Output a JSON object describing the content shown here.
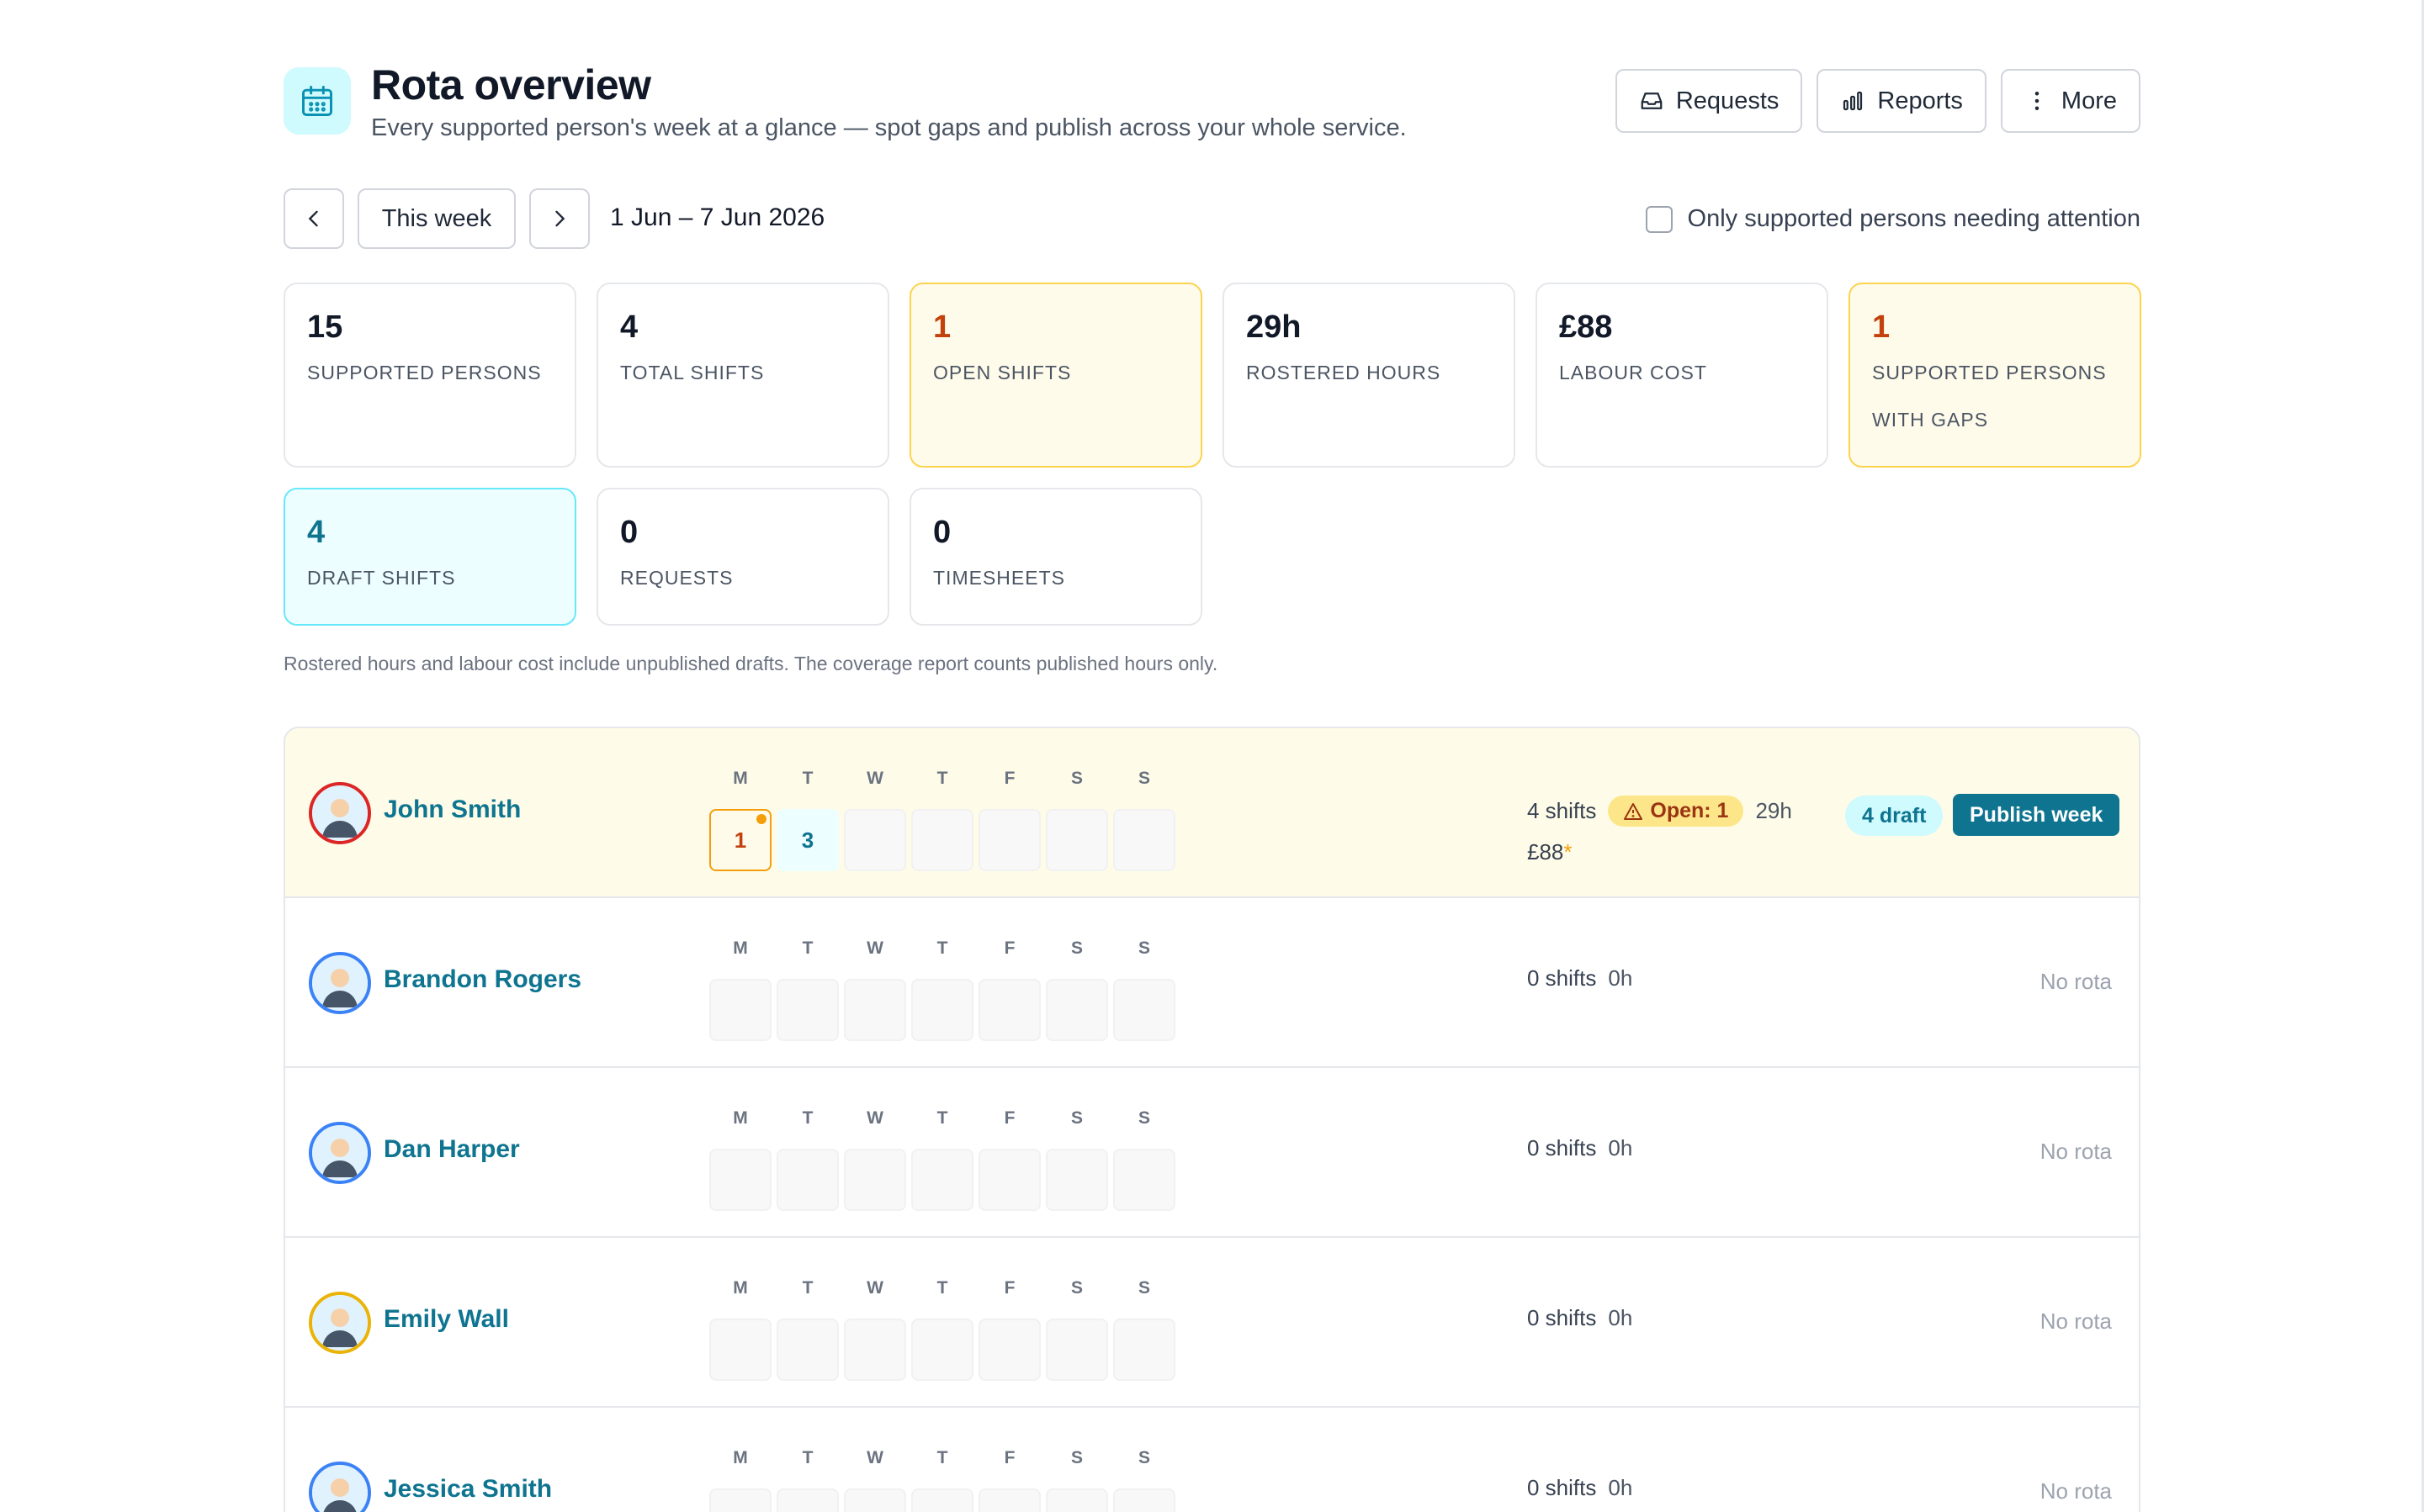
{
  "header": {
    "title": "Rota overview",
    "subtitle": "Every supported person's week at a glance — spot gaps and publish across your whole service.",
    "buttons": {
      "requests": "Requests",
      "reports": "Reports",
      "more": "More"
    }
  },
  "weeknav": {
    "this_week": "This week",
    "range": "1 Jun – 7 Jun 2026",
    "attention_filter": "Only supported persons needing attention"
  },
  "stats": [
    {
      "value": "15",
      "label": "Supported persons"
    },
    {
      "value": "4",
      "label": "Total shifts"
    },
    {
      "value": "1",
      "label": "Open shifts"
    },
    {
      "value": "29h",
      "label": "Rostered hours"
    },
    {
      "value": "£88",
      "label": "Labour cost"
    },
    {
      "value": "1",
      "label": "Supported persons with gaps"
    },
    {
      "value": "4",
      "label": "Draft shifts"
    },
    {
      "value": "0",
      "label": "Requests"
    },
    {
      "value": "0",
      "label": "Timesheets"
    }
  ],
  "note": "Rostered hours and labour cost include unpublished drafts. The coverage report counts published hours only.",
  "day_labels": [
    "M",
    "T",
    "W",
    "T",
    "F",
    "S",
    "S"
  ],
  "people": [
    {
      "name": "John Smith",
      "shifts": "4 shifts",
      "open": "Open: 1",
      "hours": "29h",
      "cost": "£88",
      "cost_mark": "*",
      "draft": "4 draft",
      "publish": "Publish week",
      "cells": [
        "1",
        "3",
        "",
        "",
        "",
        "",
        ""
      ],
      "avatar_color": "#dc2626"
    },
    {
      "name": "Brandon Rogers",
      "shifts": "0 shifts",
      "hours": "0h",
      "status": "No rota",
      "cells": [
        "",
        "",
        "",
        "",
        "",
        "",
        ""
      ],
      "avatar_color": "#3b82f6"
    },
    {
      "name": "Dan Harper",
      "shifts": "0 shifts",
      "hours": "0h",
      "status": "No rota",
      "cells": [
        "",
        "",
        "",
        "",
        "",
        "",
        ""
      ],
      "avatar_color": "#3b82f6"
    },
    {
      "name": "Emily Wall",
      "shifts": "0 shifts",
      "hours": "0h",
      "status": "No rota",
      "cells": [
        "",
        "",
        "",
        "",
        "",
        "",
        ""
      ],
      "avatar_color": "#eab308"
    },
    {
      "name": "Jessica Smith",
      "shifts": "0 shifts",
      "hours": "0h",
      "status": "No rota",
      "cells": [
        "",
        "",
        "",
        "",
        "",
        "",
        ""
      ],
      "avatar_color": "#3b82f6"
    }
  ],
  "colors": {
    "accent": "#0e7490",
    "warning": "#f59e0b",
    "warning_bg": "#fffbeb"
  }
}
